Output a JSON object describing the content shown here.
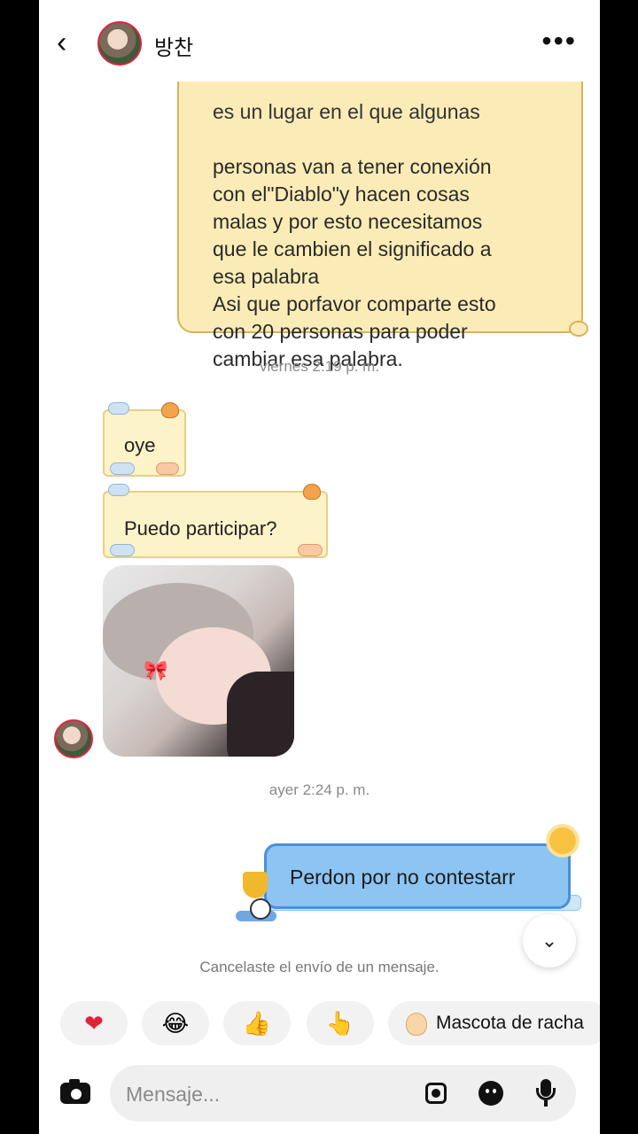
{
  "header": {
    "back_icon": "chevron-left-icon",
    "contact_name": "방찬",
    "more_icon": "more-horizontal-icon"
  },
  "messages": {
    "letter": {
      "cut_line": "es un lugar en el que algunas",
      "body": "personas van a tener conexión\ncon el\"Diablo\"y hacen cosas\nmalas y por esto necesitamos\nque le cambien el significado a\nesa palabra\nAsi que porfavor comparte esto\ncon 20 personas para poder\ncambiar esa palabra."
    },
    "timestamp_1": "viernes 2:19 p. m.",
    "received_1": "oye",
    "received_2": "Puedo participar?",
    "timestamp_2": "ayer 2:24 p. m.",
    "sent_1": "Perdon por no contestarr",
    "cancel_note": "Cancelaste el envío de un mensaje."
  },
  "reactions": [
    {
      "icon": "heart-icon",
      "glyph": "❤"
    },
    {
      "icon": "laughing-face-icon",
      "glyph": "😂"
    },
    {
      "icon": "thumbs-up-icon",
      "glyph": "👍"
    },
    {
      "icon": "pointing-hand-icon",
      "glyph": "👆"
    },
    {
      "icon": "egg-icon",
      "label": "Mascota de racha"
    }
  ],
  "composer": {
    "placeholder": "Mensaje...",
    "camera_icon": "camera-icon",
    "gallery_icon": "gallery-icon",
    "sticker_icon": "sticker-icon",
    "mic_icon": "microphone-icon"
  },
  "colors": {
    "letter_bg": "#fbecb7",
    "sent_bubble": "#8cc4f2",
    "sent_border": "#4a90d9",
    "heart": "#e0243b"
  }
}
